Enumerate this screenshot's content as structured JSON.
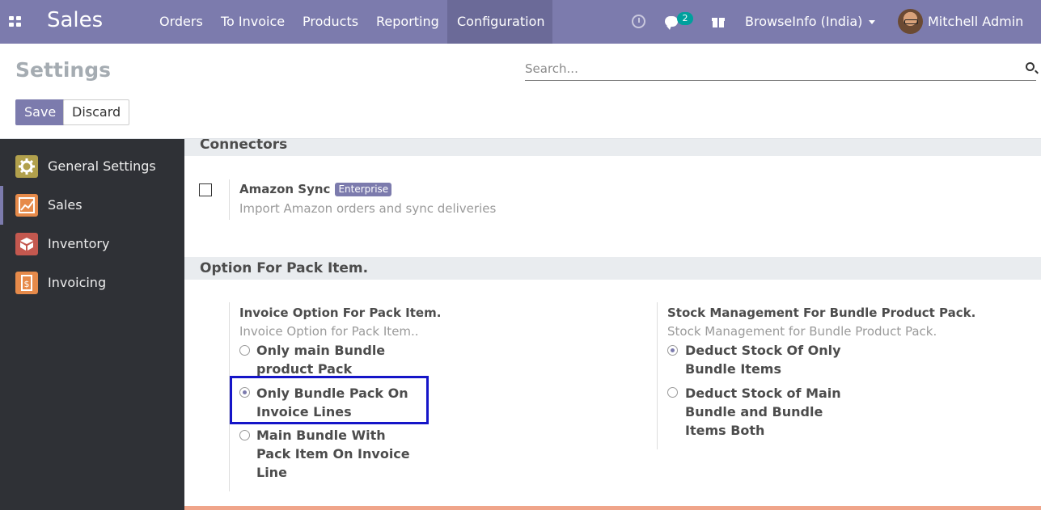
{
  "navbar": {
    "brand": "Sales",
    "menu": [
      "Orders",
      "To Invoice",
      "Products",
      "Reporting",
      "Configuration"
    ],
    "active_menu": "Configuration",
    "message_count": "2",
    "company": "BrowseInfo (India)",
    "user": "Mitchell Admin",
    "bg_color": "#7c7bad"
  },
  "control_panel": {
    "title": "Settings",
    "search_placeholder": "Search...",
    "save_label": "Save",
    "discard_label": "Discard"
  },
  "sidebar": {
    "items": [
      {
        "label": "General Settings",
        "icon": "gear-icon",
        "color": "#b1a04c"
      },
      {
        "label": "Sales",
        "icon": "chart-icon",
        "color": "#e68a4a",
        "active": true
      },
      {
        "label": "Inventory",
        "icon": "box-icon",
        "color": "#c4584f"
      },
      {
        "label": "Invoicing",
        "icon": "invoice-icon",
        "color": "#e68a4a"
      }
    ]
  },
  "sections": {
    "connectors": {
      "title": "Connectors",
      "amazon": {
        "title": "Amazon Sync",
        "badge": "Enterprise",
        "description": "Import Amazon orders and sync deliveries",
        "checked": false
      }
    },
    "pack": {
      "title": "Option For Pack Item.",
      "invoice_option": {
        "title": "Invoice Option For Pack Item.",
        "description": "Invoice Option for Pack Item..",
        "options": [
          {
            "line1": "Only main Bundle",
            "line2": "product Pack",
            "selected": false
          },
          {
            "line1": "Only Bundle Pack On",
            "line2": "Invoice Lines",
            "selected": true
          },
          {
            "line1": "Main Bundle With",
            "line2": "Pack Item On Invoice",
            "line3": "Line",
            "selected": false
          }
        ]
      },
      "stock_option": {
        "title": "Stock Management For Bundle Product Pack.",
        "description": "Stock Management for Bundle Product Pack.",
        "options": [
          {
            "line1": "Deduct Stock Of Only",
            "line2": "Bundle Items",
            "selected": true
          },
          {
            "line1": "Deduct Stock of Main",
            "line2": "Bundle and Bundle",
            "line3": "Items Both",
            "selected": false
          }
        ]
      }
    }
  }
}
